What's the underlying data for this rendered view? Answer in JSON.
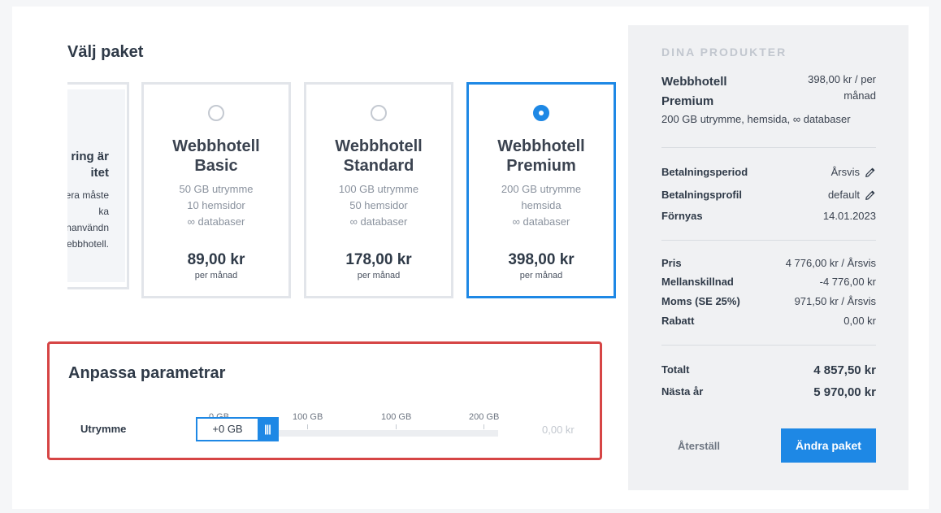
{
  "choose": {
    "title": "Välj paket"
  },
  "partial_card": {
    "title_line1": "ring är",
    "title_line2": "itet",
    "lines": [
      "era måste",
      "ka",
      "nanvändn",
      "ebbhotell."
    ]
  },
  "packages": [
    {
      "name_line1": "Webbhotell",
      "name_line2": "Basic",
      "features": [
        "50 GB utrymme",
        "10 hemsidor",
        "∞ databaser"
      ],
      "price": "89,00 kr",
      "period": "per månad",
      "selected": false
    },
    {
      "name_line1": "Webbhotell",
      "name_line2": "Standard",
      "features": [
        "100 GB utrymme",
        "50 hemsidor",
        "∞ databaser"
      ],
      "price": "178,00 kr",
      "period": "per månad",
      "selected": false
    },
    {
      "name_line1": "Webbhotell",
      "name_line2": "Premium",
      "features": [
        "200 GB utrymme",
        "hemsida",
        "∞ databaser"
      ],
      "price": "398,00 kr",
      "period": "per månad",
      "selected": true
    }
  ],
  "customize": {
    "title": "Anpassa parametrar",
    "storage_label": "Utrymme",
    "ticks": [
      "0 GB",
      "100 GB",
      "100 GB",
      "200 GB"
    ],
    "stepper_value": "+0 GB",
    "stepper_handle": "|||",
    "price": "0,00 kr"
  },
  "summary": {
    "heading": "DINA PRODUKTER",
    "product_name": "Webbhotell Premium",
    "product_price": "398,00 kr / per månad",
    "product_desc": "200 GB utrymme, hemsida, ∞ databaser",
    "billing": [
      {
        "key": "Betalningsperiod",
        "value": "Årsvis",
        "editable": true
      },
      {
        "key": "Betalningsprofil",
        "value": "default",
        "editable": true
      },
      {
        "key": "Förnyas",
        "value": "14.01.2023",
        "editable": false
      }
    ],
    "costs": [
      {
        "key": "Pris",
        "value": "4 776,00 kr / Årsvis"
      },
      {
        "key": "Mellanskillnad",
        "value": "-4 776,00 kr"
      },
      {
        "key": "Moms (SE 25%)",
        "value": "971,50 kr / Årsvis"
      },
      {
        "key": "Rabatt",
        "value": "0,00 kr"
      }
    ],
    "totals": [
      {
        "key": "Totalt",
        "value": "4 857,50 kr"
      },
      {
        "key": "Nästa år",
        "value": "5 970,00 kr"
      }
    ],
    "reset_label": "Återställ",
    "change_label": "Ändra paket"
  },
  "colors": {
    "accent": "#1e88e5",
    "highlight_border": "#d64545"
  }
}
